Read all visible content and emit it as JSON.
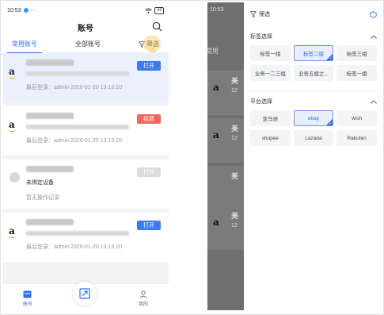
{
  "left": {
    "status": {
      "time": "10:53",
      "battery": "44"
    },
    "title": "账号",
    "tabs": [
      "常用账号",
      "全部账号"
    ],
    "filter_label": "筛选",
    "cards": [
      {
        "badge": "打开",
        "meta": "最后登录：admin  2020-01-20  13:13:20"
      },
      {
        "badge": "续费",
        "meta": "最后登录：admin  2020-01-20  13:13:20"
      },
      {
        "badge": "打开",
        "status": "未绑定设备",
        "meta": "暂无操作记录"
      },
      {
        "badge": "打开",
        "meta": "最后登录：admin  2020-01-20  13:13:20"
      }
    ],
    "bottom": {
      "accounts": "账号",
      "mine": "我的"
    }
  },
  "right": {
    "status_time": "10:53",
    "behind_tab": "常用",
    "behind_initial": "美",
    "behind_num": "12",
    "drawer": {
      "title": "筛选",
      "tag_section": "标签选择",
      "tags": [
        "标签一组",
        "标签二组",
        "标签三组",
        "业务一二三组",
        "业务五组之...",
        "标签一组"
      ],
      "platform_section": "平台选择",
      "platforms": [
        "亚马逊",
        "ebay",
        "wish",
        "shopee",
        "Lazada",
        "Rakuten"
      ]
    }
  },
  "colors": {
    "accent": "#2f6ee8",
    "renew": "#f0675c"
  }
}
